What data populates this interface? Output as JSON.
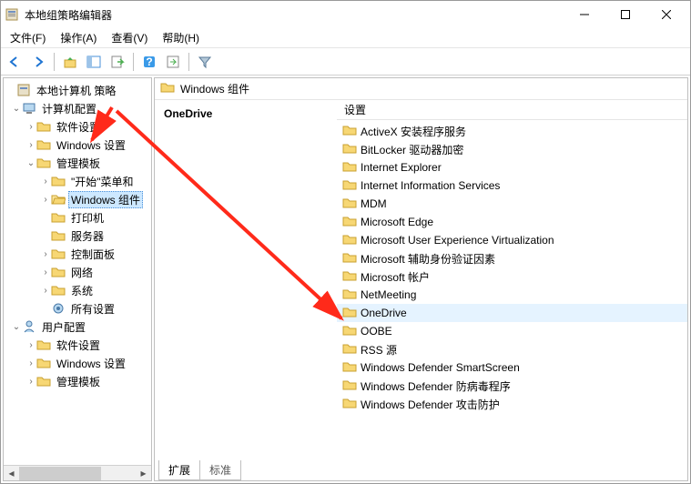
{
  "titlebar": {
    "title": "本地组策略编辑器"
  },
  "menubar": {
    "file": "文件(F)",
    "action": "操作(A)",
    "view": "查看(V)",
    "help": "帮助(H)"
  },
  "tree": {
    "root": "本地计算机 策略",
    "computer": "计算机配置",
    "software1": "软件设置",
    "winset1": "Windows 设置",
    "admintpl": "管理模板",
    "start": "\"开始\"菜单和",
    "wincomp": "Windows 组件",
    "printer": "打印机",
    "server": "服务器",
    "ctrlpanel": "控制面板",
    "network": "网络",
    "system": "系统",
    "allset": "所有设置",
    "user": "用户配置",
    "software2": "软件设置",
    "winset2": "Windows 设置",
    "admintpl2": "管理模板"
  },
  "content": {
    "header": "Windows 组件",
    "left_title": "OneDrive",
    "col_setting": "设置",
    "items": [
      "ActiveX 安装程序服务",
      "BitLocker 驱动器加密",
      "Internet Explorer",
      "Internet Information Services",
      "MDM",
      "Microsoft Edge",
      "Microsoft User Experience Virtualization",
      "Microsoft 辅助身份验证因素",
      "Microsoft 帐户",
      "NetMeeting",
      "OneDrive",
      "OOBE",
      "RSS 源",
      "Windows Defender SmartScreen",
      "Windows Defender 防病毒程序",
      "Windows Defender 攻击防护"
    ],
    "selected": 10
  },
  "tabs": {
    "extended": "扩展",
    "standard": "标准"
  }
}
